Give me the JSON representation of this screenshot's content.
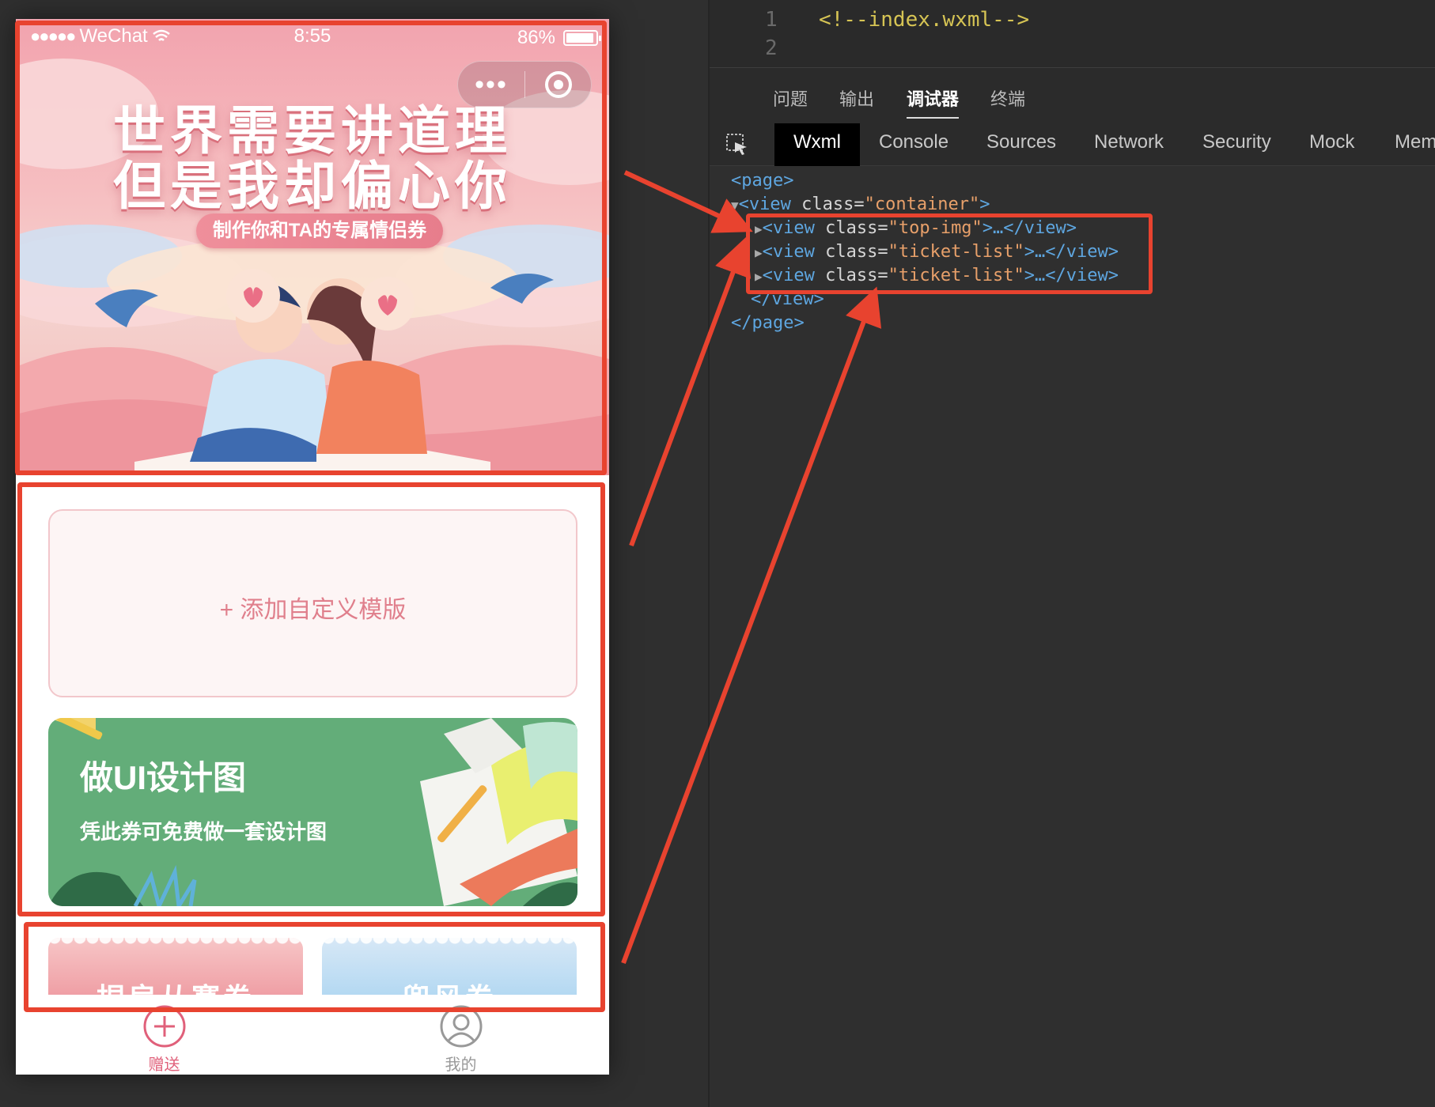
{
  "status_bar": {
    "carrier": "WeChat",
    "time": "8:55",
    "battery": "86%"
  },
  "capsule": {
    "more_glyph": "•••"
  },
  "banner": {
    "title_line1": "世界需要讲道理",
    "title_line2": "但是我却偏心你",
    "pill": "制作你和TA的专属情侣券"
  },
  "tickets": {
    "add_template": "+ 添加自定义模版",
    "green_title": "做UI设计图",
    "green_subtitle": "凭此券可免费做一套设计图",
    "mini_left": "捏肩从赛卷",
    "mini_right": "兜风券"
  },
  "tabbar": {
    "gift": "赠送",
    "mine": "我的"
  },
  "editor": {
    "line1_no": "1",
    "line2_no": "2",
    "line1_code": "<!--index.wxml-->"
  },
  "panel_tabs": [
    "问题",
    "输出",
    "调试器",
    "终端"
  ],
  "tool_tabs": [
    "Wxml",
    "Console",
    "Sources",
    "Network",
    "Security",
    "Mock",
    "Mem"
  ],
  "tree": {
    "page_open": "<page>",
    "container_tag": "<view",
    "container_attr": " class=",
    "container_val": "\"container\"",
    "container_end": ">",
    "child1_tag": "<view",
    "child1_attr": " class=",
    "child1_val": "\"top-img\"",
    "child1_end": ">…</view>",
    "child2_tag": "<view",
    "child2_attr": " class=",
    "child2_val": "\"ticket-list\"",
    "child2_end": ">…</view>",
    "child3_tag": "<view",
    "child3_attr": " class=",
    "child3_val": "\"ticket-list\"",
    "child3_end": ">…</view>",
    "view_close": "</view>",
    "page_close": "</page>"
  },
  "colors": {
    "highlight": "#e8432f",
    "accent_pink": "#e0607a",
    "green_card": "#63ad79"
  }
}
